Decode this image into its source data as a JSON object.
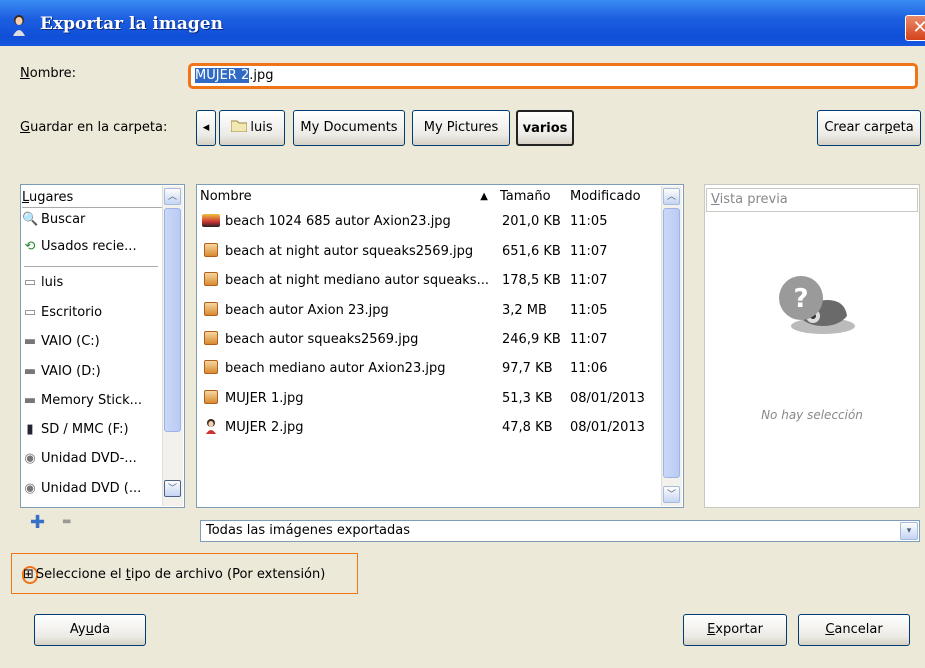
{
  "window": {
    "title": "Exportar la imagen",
    "close_glyph": "✕",
    "icon": "woman-figure-icon"
  },
  "name_field": {
    "label": "Nombre:",
    "label_underline": "N",
    "label_rest": "ombre:",
    "selected_part": "MUJER 2",
    "rest": ".jpg"
  },
  "save_in": {
    "label_underline": "G",
    "label_rest": "uardar en la carpeta:",
    "back_glyph": "◂",
    "breadcrumbs": [
      "luis",
      "My Documents",
      "My Pictures",
      "varios"
    ],
    "create_folder_pre": "Crear car",
    "create_folder_u": "p",
    "create_folder_post": "eta"
  },
  "places": {
    "header_u": "L",
    "header_rest": "ugares",
    "items": [
      {
        "icon": "search-icon",
        "glyph": "🔍",
        "label": "Buscar"
      },
      {
        "icon": "recent-icon",
        "glyph": "⟲",
        "label": "Usados recie..."
      },
      {
        "icon": "folder-icon",
        "glyph": "▭",
        "label": "luis"
      },
      {
        "icon": "folder-icon",
        "glyph": "▭",
        "label": "Escritorio"
      },
      {
        "icon": "drive-icon",
        "glyph": "▬",
        "label": "VAIO (C:)"
      },
      {
        "icon": "drive-icon",
        "glyph": "▬",
        "label": "VAIO (D:)"
      },
      {
        "icon": "memory-stick-icon",
        "glyph": "▬",
        "label": "Memory Stick..."
      },
      {
        "icon": "sd-card-icon",
        "glyph": "▮",
        "label": "SD / MMC (F:)"
      },
      {
        "icon": "dvd-icon",
        "glyph": "◉",
        "label": "Unidad DVD-..."
      },
      {
        "icon": "dvd-icon",
        "glyph": "◉",
        "label": "Unidad DVD (..."
      }
    ],
    "add_glyph": "✚",
    "remove_glyph": "▬"
  },
  "files": {
    "columns": {
      "name": "Nombre",
      "size": "Tamaño",
      "modified": "Modificado",
      "sort_glyph": "▲"
    },
    "rows": [
      {
        "icon": "img",
        "name": "beach 1024 685 autor Axion23.jpg",
        "size": "201,0 KB",
        "modified": "11:05"
      },
      {
        "icon": "jpg",
        "name": "beach at night autor squeaks2569.jpg",
        "size": "651,6 KB",
        "modified": "11:07"
      },
      {
        "icon": "jpg",
        "name": "beach at night mediano autor squeaks...",
        "size": "178,5 KB",
        "modified": "11:07"
      },
      {
        "icon": "jpg",
        "name": "beach autor Axion 23.jpg",
        "size": "3,2 MB",
        "modified": "11:05"
      },
      {
        "icon": "jpg",
        "name": "beach autor squeaks2569.jpg",
        "size": "246,9 KB",
        "modified": "11:07"
      },
      {
        "icon": "jpg",
        "name": "beach mediano autor Axion23.jpg",
        "size": "97,7 KB",
        "modified": "11:06"
      },
      {
        "icon": "jpg",
        "name": "MUJER 1.jpg",
        "size": "51,3 KB",
        "modified": "08/01/2013"
      },
      {
        "icon": "woman",
        "name": "MUJER 2.jpg",
        "size": "47,8 KB",
        "modified": "08/01/2013"
      }
    ]
  },
  "preview": {
    "checkbox_u": "V",
    "checkbox_rest": "ista previa",
    "no_selection": "No hay selección"
  },
  "filter": {
    "value": "Todas las imágenes exportadas",
    "arrow": "▾"
  },
  "file_type": {
    "expander": "⊞",
    "label_pre": "Seleccione el ",
    "label_u": "t",
    "label_post": "ipo de archivo (Por extensión)"
  },
  "buttons": {
    "help_pre": "Ay",
    "help_u": "u",
    "help_post": "da",
    "export_u": "E",
    "export_rest": "xportar",
    "cancel_u": "C",
    "cancel_rest": "ancelar"
  },
  "colors": {
    "highlight": "#f07418",
    "selection": "#316ac5",
    "titlebar": "#1d5fe0"
  }
}
